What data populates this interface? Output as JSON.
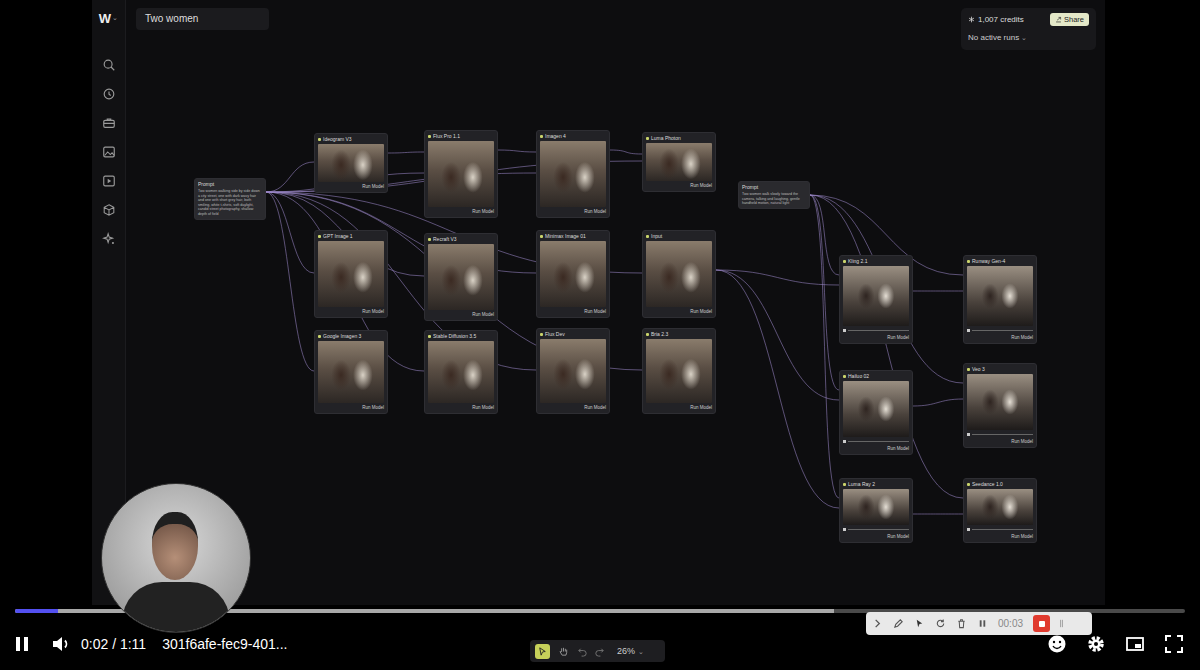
{
  "app": {
    "logo": "W",
    "logo_caret": "⌄",
    "title": "Two women",
    "credits": "1,007 credits",
    "share": "Share",
    "runs": "No active runs",
    "runs_caret": "⌄"
  },
  "prompts": [
    {
      "title": "Prompt",
      "text": "Two women walking side by side down a city street, one with dark wavy hair and one with short grey hair, both smiling, white t-shirts, soft daylight, candid street photography, shallow depth of field"
    },
    {
      "title": "Prompt",
      "text": "Two women walk slowly toward the camera, talking and laughing, gentle handheld motion, natural light"
    }
  ],
  "image_nodes": [
    {
      "title": "Ideogram V3",
      "action": "Run Model"
    },
    {
      "title": "Flux Pro 1.1",
      "action": "Run Model"
    },
    {
      "title": "Imagen 4",
      "action": "Run Model"
    },
    {
      "title": "Luma Photon",
      "action": "Run Model"
    },
    {
      "title": "GPT Image 1",
      "action": "Run Model"
    },
    {
      "title": "Recraft V3",
      "action": "Run Model"
    },
    {
      "title": "Minimax Image 01",
      "action": "Run Model"
    },
    {
      "title": "Input",
      "action": "Run Model"
    },
    {
      "title": "Google Imagen 3",
      "action": "Run Model"
    },
    {
      "title": "Stable Diffusion 3.5",
      "action": "Run Model"
    },
    {
      "title": "Flux Dev",
      "action": "Run Model"
    },
    {
      "title": "Bria 2.3",
      "action": "Run Model"
    }
  ],
  "video_nodes": [
    {
      "title": "Kling 2.1",
      "action": "Run Model"
    },
    {
      "title": "Runway Gen-4",
      "action": "Run Model"
    },
    {
      "title": "Hailuo 02",
      "action": "Run Model"
    },
    {
      "title": "Veo 3",
      "action": "Run Model"
    },
    {
      "title": "Luma Ray 2",
      "action": "Run Model"
    },
    {
      "title": "Seedance 1.0",
      "action": "Run Model"
    }
  ],
  "canvas_toolbar": {
    "tools": [
      {
        "selected": true
      },
      {
        "selected": false
      }
    ],
    "zoom": "26%",
    "caret": "⌄"
  },
  "player": {
    "playing": true,
    "time": "0:02 / 1:11",
    "file": "301f6afe-fec9-401...",
    "played": 0.037,
    "buffered": 0.7
  },
  "recorder": {
    "recording": true,
    "timer": "00:03"
  }
}
